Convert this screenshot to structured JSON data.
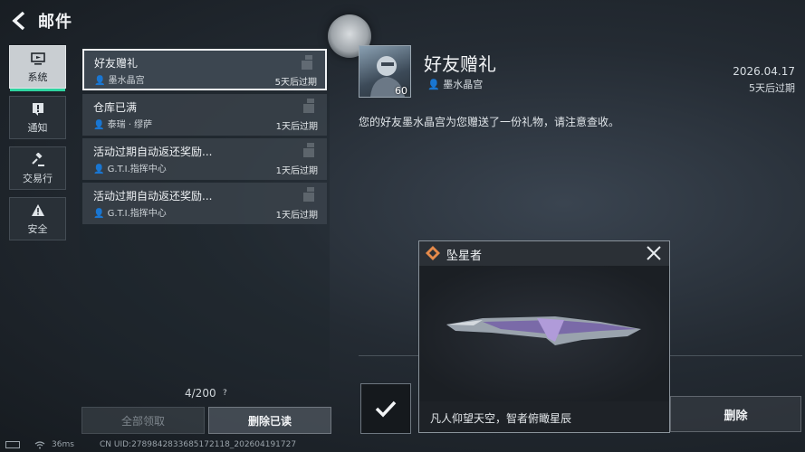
{
  "header": {
    "title": "邮件",
    "back_icon": "back-arrow-icon"
  },
  "categories": [
    {
      "label": "系统",
      "icon": "monitor-icon",
      "active": true
    },
    {
      "label": "通知",
      "icon": "notice-icon",
      "active": false
    },
    {
      "label": "交易行",
      "icon": "gavel-icon",
      "active": false
    },
    {
      "label": "安全",
      "icon": "warning-icon",
      "active": false
    }
  ],
  "mails": [
    {
      "title": "好友赠礼",
      "sender": "墨水晶宫",
      "expire": "5天后过期",
      "active": true
    },
    {
      "title": "仓库已满",
      "sender": "泰瑞 · 缪萨",
      "expire": "1天后过期",
      "active": false
    },
    {
      "title": "活动过期自动返还奖励...",
      "sender": "G.T.I.指挥中心",
      "expire": "1天后过期",
      "active": false
    },
    {
      "title": "活动过期自动返还奖励...",
      "sender": "G.T.I.指挥中心",
      "expire": "1天后过期",
      "active": false
    }
  ],
  "list_footer": {
    "count": "4/200",
    "help": "?",
    "claim_all": "全部领取",
    "delete_read": "删除已读"
  },
  "detail": {
    "avatar_level": "60",
    "title": "好友赠礼",
    "sender": "墨水晶宫",
    "date": "2026.04.17",
    "expire": "5天后过期",
    "body": "您的好友墨水晶宫为您赠送了一份礼物，请注意查收。"
  },
  "popup": {
    "name": "坠星者",
    "description": "凡人仰望天空，智者俯瞰星辰",
    "item_color": "#8a6fc9"
  },
  "actions": {
    "delete": "删除"
  },
  "status": {
    "ping": "36ms",
    "uid": "CN UID:27898428336851721​18_202604191727"
  }
}
